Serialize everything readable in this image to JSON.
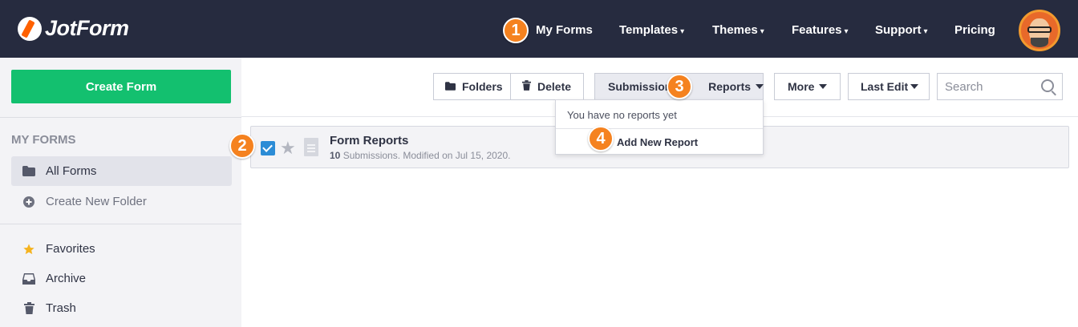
{
  "brand": {
    "name": "JotForm"
  },
  "nav": {
    "my_forms": "My Forms",
    "templates": "Templates",
    "themes": "Themes",
    "features": "Features",
    "support": "Support",
    "pricing": "Pricing",
    "caret": "▾"
  },
  "sidebar": {
    "create_form": "Create Form",
    "section_title": "MY FORMS",
    "all_forms": "All Forms",
    "create_folder": "Create New Folder",
    "favorites": "Favorites",
    "archive": "Archive",
    "trash": "Trash"
  },
  "toolbar": {
    "folders": "Folders",
    "delete": "Delete",
    "submissions": "Submissions",
    "reports": "Reports",
    "more": "More",
    "last_edit": "Last Edit",
    "search_placeholder": "Search"
  },
  "form": {
    "title": "Form Reports",
    "submission_count": "10",
    "meta_rest": " Submissions. Modified on Jul 15, 2020."
  },
  "reports_menu": {
    "empty_text": "You have no reports yet",
    "add_new": "Add New Report"
  },
  "badges": [
    "1",
    "2",
    "3",
    "4"
  ],
  "colors": {
    "topbar": "#262b3f",
    "create_button": "#13c06f",
    "badge": "#f5821f",
    "checkbox": "#2c8cd6"
  }
}
